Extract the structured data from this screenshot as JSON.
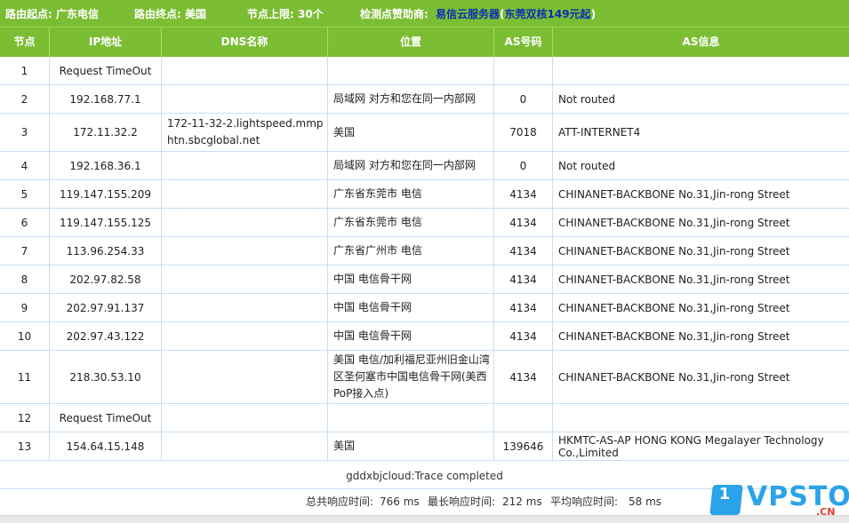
{
  "topbar": {
    "start_label": "路由起点: 广东电信",
    "end_label": "路由终点: 美国",
    "hop_limit_label": "节点上限: 30个",
    "sponsor_prefix": "检测点赞助商:",
    "sponsor_name": "易信云服务器",
    "sponsor_paren_open": "(",
    "sponsor_detail": "东莞双核149元起",
    "sponsor_paren_close": ")"
  },
  "table": {
    "headers": [
      "节点",
      "IP地址",
      "DNS名称",
      "位置",
      "AS号码",
      "AS信息"
    ],
    "rows": [
      {
        "hop": "1",
        "ip": "Request TimeOut",
        "dns": "",
        "location": "",
        "asn": "",
        "asinfo": ""
      },
      {
        "hop": "2",
        "ip": "192.168.77.1",
        "dns": "",
        "location": "局域网 对方和您在同一内部网",
        "asn": "0",
        "asinfo": "Not routed"
      },
      {
        "hop": "3",
        "ip": "172.11.32.2",
        "dns": "172-11-32-2.lightspeed.mmphtn.sbcglobal.net",
        "location": "美国",
        "asn": "7018",
        "asinfo": "ATT-INTERNET4"
      },
      {
        "hop": "4",
        "ip": "192.168.36.1",
        "dns": "",
        "location": "局域网 对方和您在同一内部网",
        "asn": "0",
        "asinfo": "Not routed"
      },
      {
        "hop": "5",
        "ip": "119.147.155.209",
        "dns": "",
        "location": "广东省东莞市 电信",
        "asn": "4134",
        "asinfo": "CHINANET-BACKBONE No.31,Jin-rong Street"
      },
      {
        "hop": "6",
        "ip": "119.147.155.125",
        "dns": "",
        "location": "广东省东莞市 电信",
        "asn": "4134",
        "asinfo": "CHINANET-BACKBONE No.31,Jin-rong Street"
      },
      {
        "hop": "7",
        "ip": "113.96.254.33",
        "dns": "",
        "location": "广东省广州市 电信",
        "asn": "4134",
        "asinfo": "CHINANET-BACKBONE No.31,Jin-rong Street"
      },
      {
        "hop": "8",
        "ip": "202.97.82.58",
        "dns": "",
        "location": "中国 电信骨干网",
        "asn": "4134",
        "asinfo": "CHINANET-BACKBONE No.31,Jin-rong Street"
      },
      {
        "hop": "9",
        "ip": "202.97.91.137",
        "dns": "",
        "location": "中国 电信骨干网",
        "asn": "4134",
        "asinfo": "CHINANET-BACKBONE No.31,Jin-rong Street"
      },
      {
        "hop": "10",
        "ip": "202.97.43.122",
        "dns": "",
        "location": "中国 电信骨干网",
        "asn": "4134",
        "asinfo": "CHINANET-BACKBONE No.31,Jin-rong Street"
      },
      {
        "hop": "11",
        "ip": "218.30.53.10",
        "dns": "",
        "location": "美国 电信/加利福尼亚州旧金山湾区圣何塞市中国电信骨干网(美西PoP接入点)",
        "asn": "4134",
        "asinfo": "CHINANET-BACKBONE No.31,Jin-rong Street"
      },
      {
        "hop": "12",
        "ip": "Request TimeOut",
        "dns": "",
        "location": "",
        "asn": "",
        "asinfo": ""
      },
      {
        "hop": "13",
        "ip": "154.64.15.148",
        "dns": "",
        "location": "美国",
        "asn": "139646",
        "asinfo": "HKMTC-AS-AP HONG KONG Megalayer Technology Co.,Limited"
      }
    ]
  },
  "footer": {
    "trace_message": "gddxbjcloud:Trace completed",
    "total_label": "总共响应时间:",
    "total_value": "766 ms",
    "max_label": "最长响应时间:",
    "max_value": "212 ms",
    "avg_label": "平均响应时间:",
    "avg_value": "58 ms"
  },
  "watermark": {
    "logo_digit": "1",
    "logo_text": "VPSTOP",
    "logo_suffix": ".CN"
  },
  "colors": {
    "header_green": "#7bbd33",
    "sponsor_link": "#0b2fb5",
    "grid_line": "#c9def2",
    "watermark_blue": "#2aa3e8",
    "watermark_red": "#e03a2f"
  }
}
